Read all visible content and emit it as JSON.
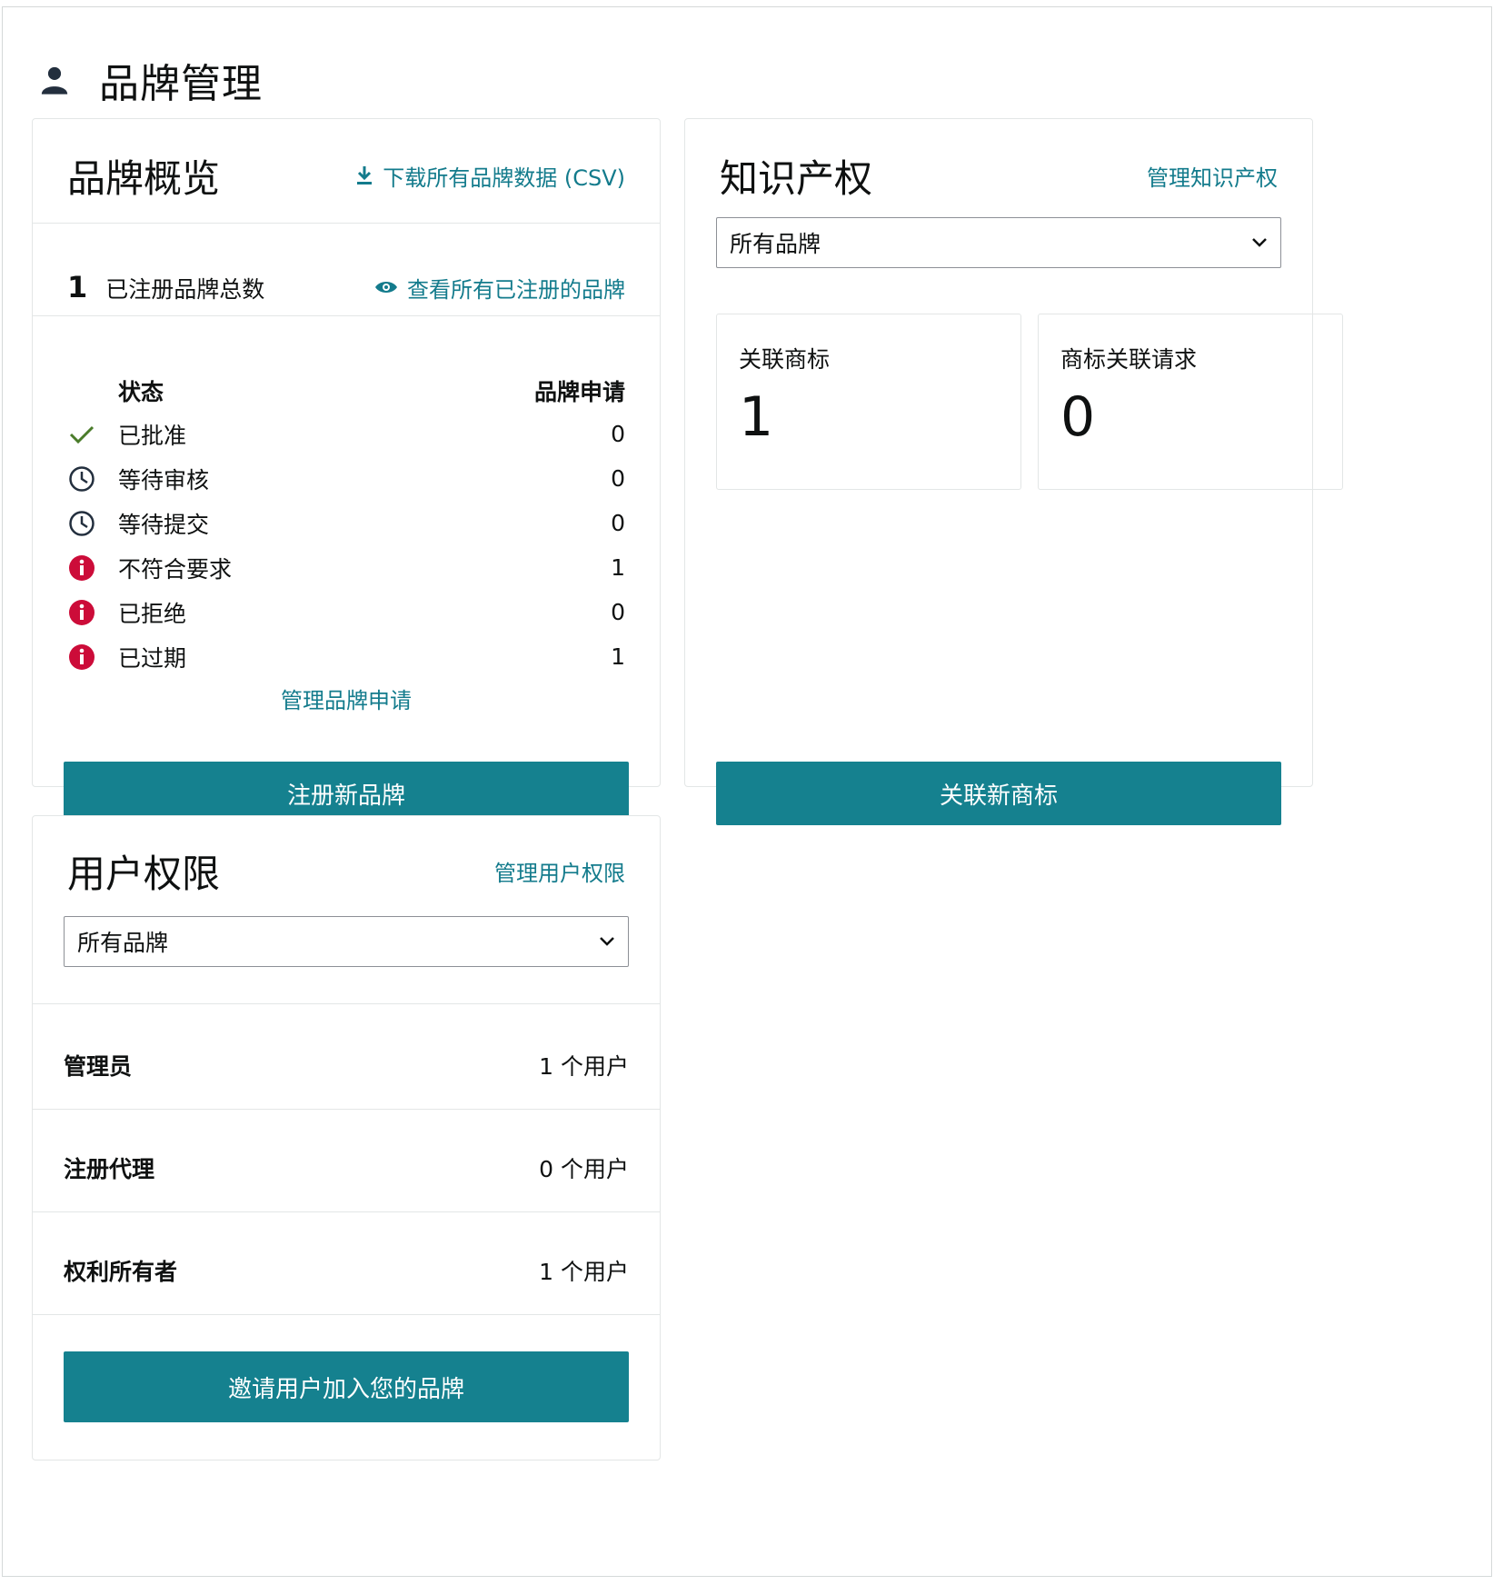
{
  "page": {
    "title": "品牌管理",
    "icon": "user-icon"
  },
  "brand_overview": {
    "title": "品牌概览",
    "download_link": "下载所有品牌数据 (CSV)",
    "total_count": "1",
    "total_label": "已注册品牌总数",
    "view_all_link": "查看所有已注册的品牌",
    "table_header": {
      "status": "状态",
      "applications": "品牌申请"
    },
    "statuses": [
      {
        "label": "已批准",
        "count": "0",
        "icon": "check-icon"
      },
      {
        "label": "等待审核",
        "count": "0",
        "icon": "clock-icon"
      },
      {
        "label": "等待提交",
        "count": "0",
        "icon": "clock-icon"
      },
      {
        "label": "不符合要求",
        "count": "1",
        "icon": "alert-icon"
      },
      {
        "label": "已拒绝",
        "count": "0",
        "icon": "alert-icon"
      },
      {
        "label": "已过期",
        "count": "1",
        "icon": "alert-icon"
      }
    ],
    "manage_link": "管理品牌申请",
    "register_button": "注册新品牌"
  },
  "ip": {
    "title": "知识产权",
    "manage_link": "管理知识产权",
    "select_value": "所有品牌",
    "metrics": [
      {
        "label": "关联商标",
        "value": "1"
      },
      {
        "label": "商标关联请求",
        "value": "0"
      }
    ],
    "link_button": "关联新商标"
  },
  "user_permissions": {
    "title": "用户权限",
    "manage_link": "管理用户权限",
    "select_value": "所有品牌",
    "roles": [
      {
        "role": "管理员",
        "count": "1 个用户"
      },
      {
        "role": "注册代理",
        "count": "0 个用户"
      },
      {
        "role": "权利所有者",
        "count": "1 个用户"
      }
    ],
    "invite_button": "邀请用户加入您的品牌"
  },
  "colors": {
    "accent": "#15818f",
    "link": "#137b8c",
    "success": "#4a7c2a",
    "error": "#cc0c39"
  }
}
